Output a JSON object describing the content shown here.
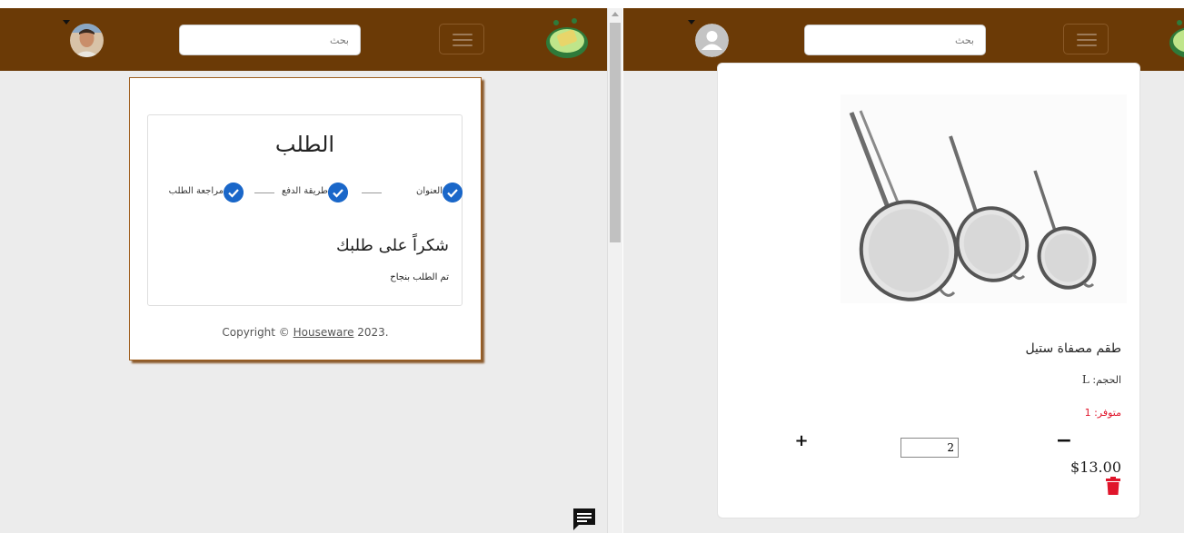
{
  "left": {
    "search": {
      "placeholder": "بحث"
    },
    "order": {
      "title": "الطلب",
      "steps": [
        "العنوان",
        "طريقة الدفع",
        "مراجعة الطلب"
      ],
      "thanks": "شكراً على طلبك",
      "success": "تم الطلب بنجاح"
    },
    "footer": {
      "prefix": "Copyright © ",
      "brand": "Houseware",
      "suffix": " 2023."
    }
  },
  "right": {
    "search": {
      "placeholder": "بحث"
    },
    "product": {
      "name": "طقم مصفاة ستيل",
      "size_label": "الحجم:",
      "size_value": "L",
      "stock_label": "متوفر:",
      "stock_value": "1",
      "minus_label": "−",
      "plus_label": "+",
      "quantity": "2",
      "price": "$13.00"
    }
  },
  "colors": {
    "navbar": "#6b3a06",
    "step_check": "#1a67c9",
    "stock_text": "#e0152b",
    "trash_icon": "#e0152b"
  }
}
